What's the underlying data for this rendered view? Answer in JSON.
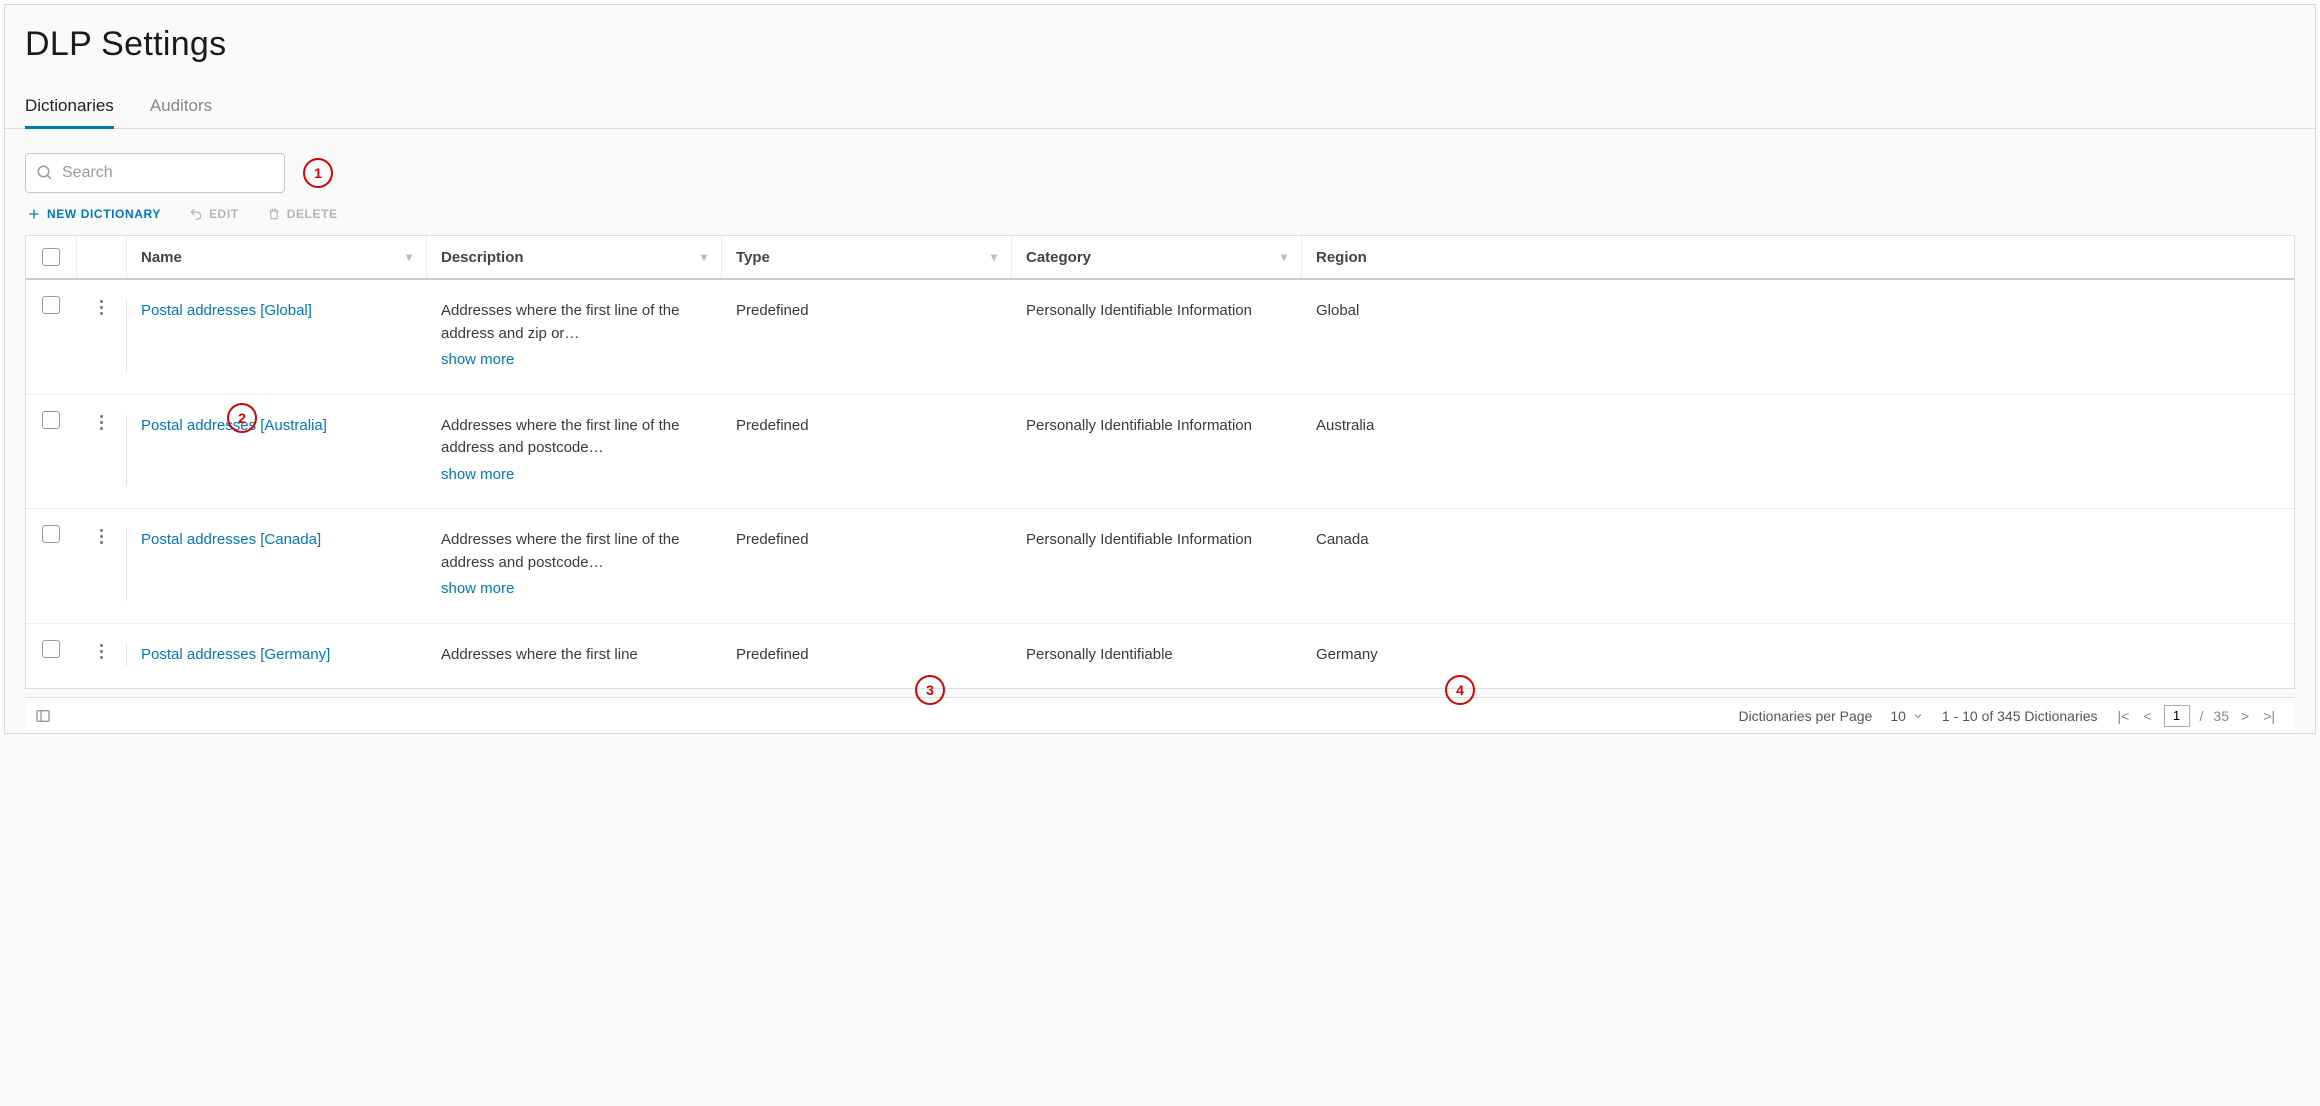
{
  "page": {
    "title": "DLP Settings"
  },
  "tabs": [
    {
      "label": "Dictionaries",
      "active": true
    },
    {
      "label": "Auditors",
      "active": false
    }
  ],
  "search": {
    "placeholder": "Search"
  },
  "toolbar": {
    "new_label": "NEW DICTIONARY",
    "edit_label": "EDIT",
    "delete_label": "DELETE"
  },
  "columns": {
    "name": "Name",
    "description": "Description",
    "type": "Type",
    "category": "Category",
    "region": "Region"
  },
  "show_more": "show more",
  "rows": [
    {
      "name": "Postal addresses [Global]",
      "description": "Addresses where the first line of the address and zip or…",
      "type": "Predefined",
      "category": "Personally Identifiable Information",
      "region": "Global"
    },
    {
      "name": "Postal addresses [Australia]",
      "description": "Addresses where the first line of the address and postcode…",
      "type": "Predefined",
      "category": "Personally Identifiable Information",
      "region": "Australia"
    },
    {
      "name": "Postal addresses [Canada]",
      "description": "Addresses where the first line of the address and postcode…",
      "type": "Predefined",
      "category": "Personally Identifiable Information",
      "region": "Canada"
    },
    {
      "name": "Postal addresses [Germany]",
      "description": "Addresses where the first line",
      "type": "Predefined",
      "category": "Personally Identifiable",
      "region": "Germany"
    }
  ],
  "pager": {
    "per_page_label": "Dictionaries per Page",
    "per_page_value": "10",
    "range_text": "1 - 10 of 345 Dictionaries",
    "current_page": "1",
    "total_pages": "35"
  },
  "callouts": [
    "1",
    "2",
    "3",
    "4"
  ]
}
